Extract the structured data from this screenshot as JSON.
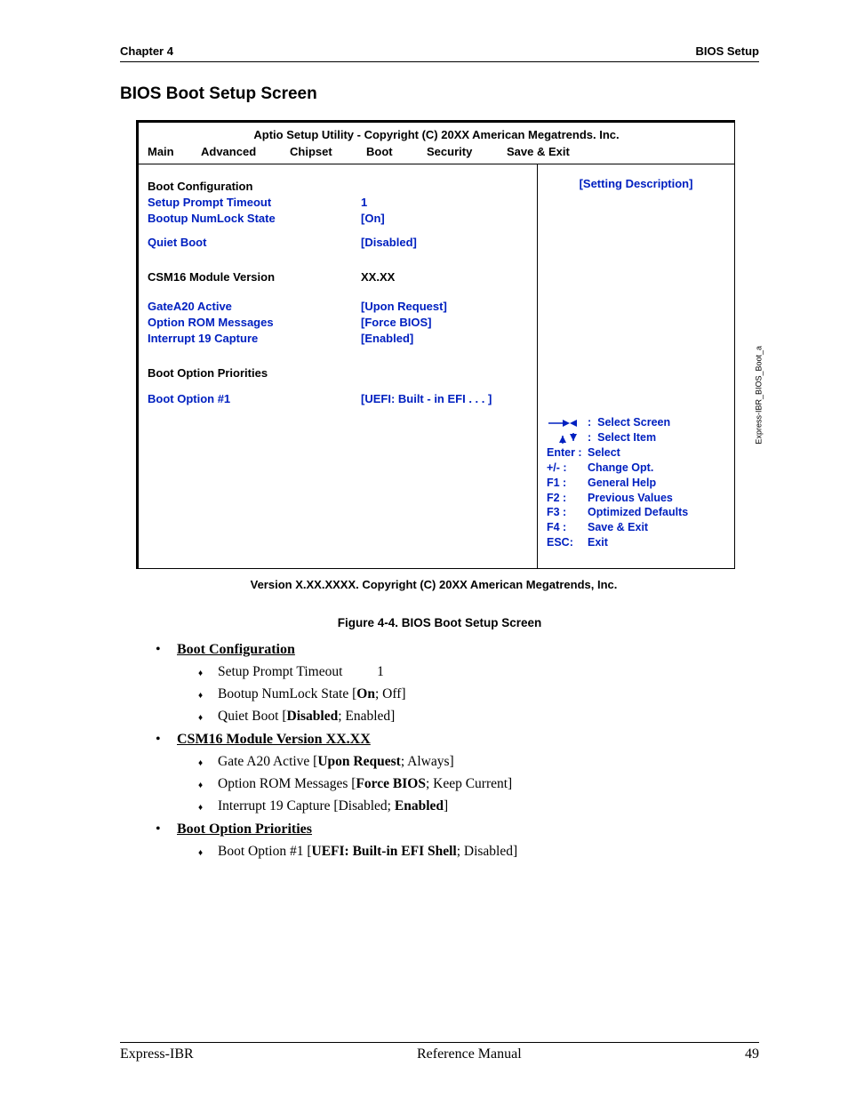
{
  "header": {
    "left": "Chapter 4",
    "right": "BIOS Setup"
  },
  "section_title": "BIOS Boot Setup Screen",
  "bios": {
    "title": "Aptio Setup Utility - Copyright (C) 20XX American Megatrends. Inc.",
    "tabs": [
      "Main",
      "Advanced",
      "Chipset",
      "Boot",
      "Security",
      "Save & Exit"
    ],
    "rows": {
      "boot_config": "Boot Configuration",
      "spt_label": "Setup Prompt Timeout",
      "spt_val": "1",
      "bns_label": "Bootup NumLock State",
      "bns_val": "[On]",
      "qb_label": "Quiet Boot",
      "qb_val": "[Disabled]",
      "csm_label": "CSM16 Module Version",
      "csm_val": "XX.XX",
      "ga_label": "GateA20 Active",
      "ga_val": "[Upon Request]",
      "orm_label": "Option ROM Messages",
      "orm_val": "[Force BIOS]",
      "i19_label": "Interrupt 19 Capture",
      "i19_val": "[Enabled]",
      "bop_head": "Boot Option Priorities",
      "bo1_label": "Boot Option #1",
      "bo1_val": "[UEFI: Built - in EFI . . . ]"
    },
    "help_top": "[Setting Description]",
    "keys": {
      "ss": "Select Screen",
      "si": "Select Item",
      "enter_k": "Enter :",
      "enter_v": "Select",
      "pm_k": "+/- :",
      "pm_v": "Change Opt.",
      "f1_k": "F1 :",
      "f1_v": "General Help",
      "f2_k": "F2 :",
      "f2_v": "Previous Values",
      "f3_k": "F3 :",
      "f3_v": "Optimized Defaults",
      "f4_k": "F4 :",
      "f4_v": "Save & Exit",
      "esc_k": "ESC:",
      "esc_v": "Exit"
    },
    "side_label": "Express-IBR_BIOS_Boot_a"
  },
  "bios_footnote": "Version X.XX.XXXX.  Copyright (C) 20XX  American Megatrends, Inc.",
  "figure_caption": "Figure  4-4.   BIOS Boot Setup Screen",
  "desc": {
    "h1": "Boot Configuration",
    "d1a_pre": "Setup Prompt Timeout",
    "d1a_mid": "1",
    "d1b_pre": "Bootup NumLock State [",
    "d1b_bold": "On",
    "d1b_post": "; Off]",
    "d1c_pre": "Quiet Boot [",
    "d1c_bold": "Disabled",
    "d1c_post": "; Enabled]",
    "h2": "CSM16 Module Version XX.XX",
    "d2a_pre": "Gate A20 Active [",
    "d2a_bold": "Upon Request",
    "d2a_post": "; Always]",
    "d2b_pre": "Option ROM Messages [",
    "d2b_bold": "Force BIOS",
    "d2b_post": "; Keep Current]",
    "d2c_pre": "Interrupt 19 Capture [Disabled; ",
    "d2c_bold": "Enabled",
    "d2c_post": "]",
    "h3": "Boot Option Priorities",
    "d3a_pre": "Boot Option #1 [",
    "d3a_bold": "UEFI: Built-in EFI Shell",
    "d3a_post": "; Disabled]"
  },
  "footer": {
    "left": "Express-IBR",
    "center": "Reference Manual",
    "right": "49"
  }
}
